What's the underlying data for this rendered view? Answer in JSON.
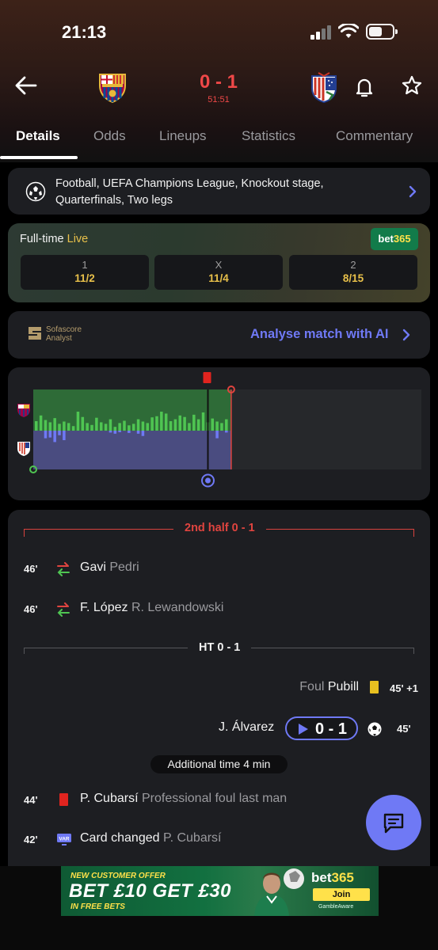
{
  "status_bar": {
    "time": "21:13"
  },
  "match": {
    "home_team_icon": "fc-barcelona-crest",
    "away_team_icon": "atletico-madrid-crest",
    "score": "0 - 1",
    "minute": "51:51"
  },
  "tabs": [
    {
      "label": "Details",
      "active": true
    },
    {
      "label": "Odds",
      "active": false
    },
    {
      "label": "Lineups",
      "active": false
    },
    {
      "label": "Statistics",
      "active": false
    },
    {
      "label": "Commentary",
      "active": false
    }
  ],
  "competition": {
    "icon": "champions-league-ball-icon",
    "text": "Football, UEFA Champions League, Knockout stage, Quarterfinals, Two legs"
  },
  "odds": {
    "title": "Full-time",
    "live_label": "Live",
    "bookmaker_first": "bet",
    "bookmaker_second": "365",
    "options": [
      {
        "label": "1",
        "value": "11/2"
      },
      {
        "label": "X",
        "value": "11/4"
      },
      {
        "label": "2",
        "value": "8/15"
      }
    ]
  },
  "analyst": {
    "logo_line1": "Sofascore",
    "logo_line2": "Analyst",
    "link": "Analyse match with AI"
  },
  "momentum": {
    "home_values": [
      0.25,
      0.4,
      0.28,
      0.22,
      0.33,
      0.18,
      0.24,
      0.2,
      0.12,
      0.5,
      0.36,
      0.2,
      0.15,
      0.34,
      0.22,
      0.18,
      0.3,
      0.1,
      0.2,
      0.26,
      0.14,
      0.18,
      0.3,
      0.24,
      0.2,
      0.35,
      0.38,
      0.5,
      0.45,
      0.25,
      0.3,
      0.4,
      0.36,
      0.2,
      0.42,
      0.3,
      0.48,
      0.22,
      0.32,
      0.24,
      0.2,
      0.3
    ],
    "away_values": [
      0,
      0,
      0.2,
      0.18,
      0.3,
      0.12,
      0.25,
      0,
      0,
      0,
      0,
      0,
      0,
      0,
      0,
      0,
      0.05,
      0.08,
      0.04,
      0,
      0.06,
      0,
      0.08,
      0.14,
      0,
      0,
      0,
      0,
      0,
      0,
      0,
      0,
      0,
      0,
      0,
      0,
      0,
      0,
      0,
      0.2,
      0,
      0.05
    ],
    "current_minute_ratio": 0.51,
    "halftime_ratio": 0.45,
    "colors": {
      "home": "#2e6b37",
      "away": "#4a4c80",
      "home_bar": "#4fc552",
      "away_bar": "#6f79f5",
      "red": "#e0443f"
    }
  },
  "separators": {
    "second_half": "2nd half 0 - 1",
    "halftime": "HT 0 - 1"
  },
  "events": [
    {
      "minute": "46'",
      "type": "substitution",
      "player_in": "Gavi",
      "player_out": "Pedri"
    },
    {
      "minute": "46'",
      "type": "substitution",
      "player_in": "F. López",
      "player_out": "R. Lewandowski"
    },
    {
      "minute": "45' +1",
      "type": "yellow-card",
      "player": "Pubill",
      "reason": "Foul"
    },
    {
      "minute": "45'",
      "type": "goal",
      "player": "J. Álvarez",
      "score": "0 - 1"
    },
    {
      "minute": "44'",
      "type": "red-card",
      "player": "P. Cubarsí",
      "reason": "Professional foul last man"
    },
    {
      "minute": "42'",
      "type": "var",
      "label": "Card changed",
      "player": "P. Cubarsí"
    }
  ],
  "additional_time": "Additional time 4 min",
  "ad": {
    "offer": "NEW CUSTOMER OFFER",
    "headline": "BET £10 GET £30",
    "subline": "IN FREE BETS",
    "brand_first": "bet",
    "brand_second": "365",
    "cta": "Join",
    "footer": "GambleAware"
  }
}
